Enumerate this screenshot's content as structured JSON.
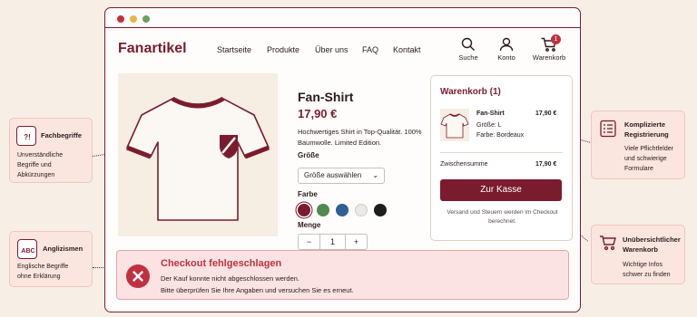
{
  "colors": {
    "brand": "#7a1c2e",
    "error": "#c0313f",
    "background": "#f7efe6"
  },
  "header": {
    "logo": "Fanartikel",
    "nav": [
      "Startseite",
      "Produkte",
      "Über uns",
      "FAQ",
      "Kontakt"
    ],
    "icons": {
      "search": "Suche",
      "account": "Konto",
      "cart": "Warenkorb",
      "cart_count": "1"
    }
  },
  "product": {
    "title": "Fan-Shirt",
    "price": "17,90 €",
    "description": "Hochwertiges Shirt in Top-Qualität. 100% Baumwolle. Limited Edition.",
    "size_label": "Größe",
    "size_select": "Größe auswählen",
    "color_label": "Farbe",
    "colors": [
      "#7a1c2e",
      "#4f8a4f",
      "#2f5f95",
      "#ece9e6",
      "#1d1d1d"
    ],
    "quantity_label": "Menge",
    "qty_minus": "−",
    "qty_value": "1",
    "qty_plus": "+"
  },
  "cart": {
    "title": "Warenkorb (1)",
    "item_name": "Fan-Shirt",
    "item_size": "Größe: L",
    "item_color": "Farbe: Bordeaux",
    "item_price": "17,90 €",
    "subtotal_label": "Zwischensumme",
    "subtotal_value": "17,90 €",
    "checkout_button": "Zur Kasse",
    "note": "Versand und Steuern werden im Checkout berechnet."
  },
  "error": {
    "title": "Checkout fehlgeschlagen",
    "line1": "Der Kauf konnte nicht abgeschlossen werden.",
    "line2": "Bitte überprüfen Sie Ihre Angaben und versuchen Sie es erneut."
  },
  "callouts": {
    "fachbegriffe": {
      "title": "Fachbegriffe",
      "body1": "Unverständliche",
      "body2": "Begriffe und",
      "body3": "Abkürzungen",
      "icon_text": "?!"
    },
    "anglizismen": {
      "title": "Anglizismen",
      "body1": "Englische Begriffe",
      "body2": "ohne Erklärung",
      "icon_text": "ABC"
    },
    "registrierung": {
      "title": "Komplizierte",
      "title2": "Registrierung",
      "body1": "Viele Pflichtfelder",
      "body2": "und schwierige",
      "body3": "Formulare"
    },
    "warenkorb": {
      "title": "Unübersichtlicher",
      "title2": "Warenkorb",
      "body1": "Wichtige Infos",
      "body2": "schwer zu finden"
    }
  }
}
